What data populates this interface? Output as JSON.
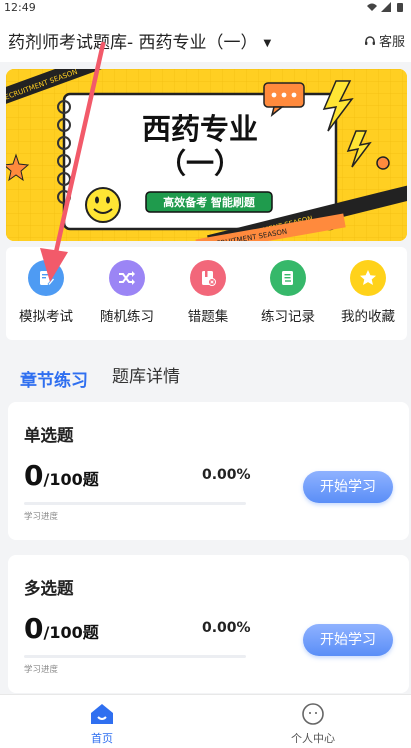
{
  "status": {
    "time": "12:49"
  },
  "header": {
    "title": "药剂师考试题库- 西药专业（一）",
    "service_label": "客服"
  },
  "banner": {
    "title_line1": "西药专业",
    "title_line2": "（一）",
    "slogan": "高效备考  智能刷题",
    "tape_text": "RECRUITMENT SEASON",
    "colors": {
      "background": "#ffcf22",
      "accent": "#ff8a3d",
      "green": "#1f9b4d"
    }
  },
  "quick_actions": [
    {
      "label": "模拟考试",
      "icon": "document-edit-icon",
      "color": "#4e9bf3"
    },
    {
      "label": "随机练习",
      "icon": "shuffle-icon",
      "color": "#9b85f5"
    },
    {
      "label": "错题集",
      "icon": "error-book-icon",
      "color": "#f2677a"
    },
    {
      "label": "练习记录",
      "icon": "record-icon",
      "color": "#36b86a"
    },
    {
      "label": "我的收藏",
      "icon": "star-icon",
      "color": "#ffd21a"
    }
  ],
  "tabs": {
    "active": "章节练习",
    "inactive": "题库详情"
  },
  "cards": [
    {
      "title": "单选题",
      "done": "0",
      "total": "/100题",
      "percent": "0.00%",
      "progress": 0,
      "progress_label": "学习进度",
      "button": "开始学习"
    },
    {
      "title": "多选题",
      "done": "0",
      "total": "/100题",
      "percent": "0.00%",
      "progress": 0,
      "progress_label": "学习进度",
      "button": "开始学习"
    }
  ],
  "bottom_nav": [
    {
      "label": "首页",
      "active": true,
      "color": "#2f6ff0"
    },
    {
      "label": "个人中心",
      "active": false,
      "color": "#666666"
    }
  ]
}
